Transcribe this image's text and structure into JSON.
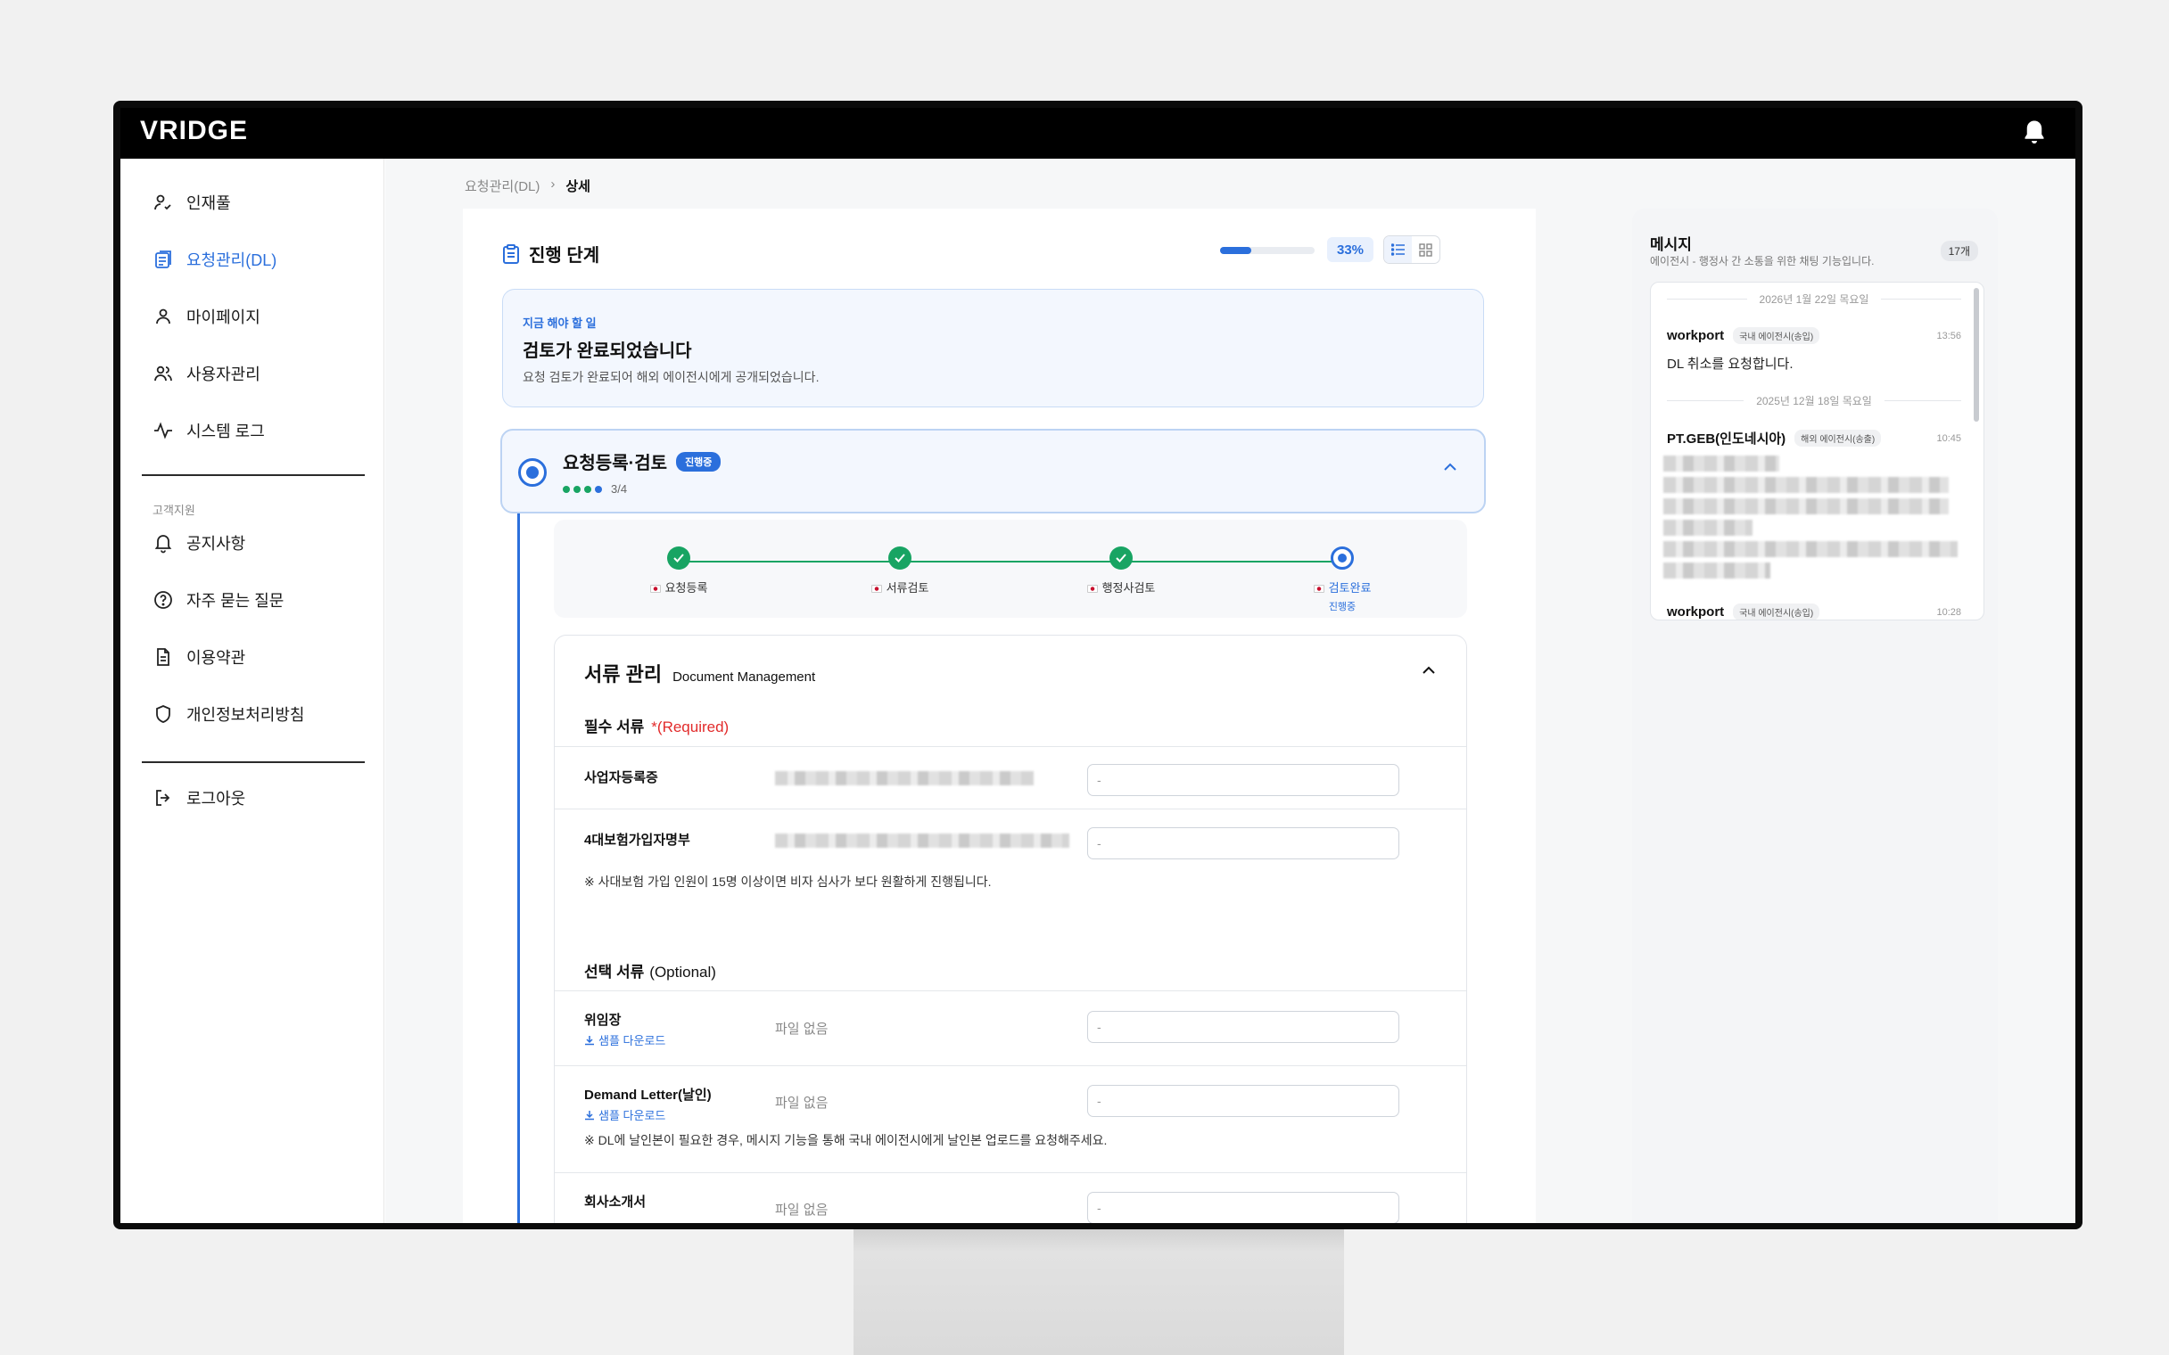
{
  "app": {
    "logo": "VRIDGE"
  },
  "sidebar": {
    "items": [
      {
        "label": "인재풀"
      },
      {
        "label": "요청관리(DL)"
      },
      {
        "label": "마이페이지"
      },
      {
        "label": "사용자관리"
      },
      {
        "label": "시스템 로그"
      }
    ],
    "section": "고객지원",
    "support": [
      {
        "label": "공지사항"
      },
      {
        "label": "자주 묻는 질문"
      },
      {
        "label": "이용약관"
      },
      {
        "label": "개인정보처리방침"
      }
    ],
    "logout": "로그아웃"
  },
  "breadcrumb": {
    "parent": "요청관리(DL)",
    "sep": "›",
    "current": "상세"
  },
  "progress": {
    "title": "진행 단계",
    "percent_label": "33%",
    "percent": 33
  },
  "todo": {
    "tag": "지금 해야 할 일",
    "title": "검토가 완료되었습니다",
    "desc": "요청 검토가 완료되어 해외 에이전시에게 공개되었습니다."
  },
  "stage": {
    "title": "요청등록·검토",
    "badge": "진행중",
    "count": "3/4"
  },
  "steps": [
    {
      "label": "요청등록",
      "status": "done"
    },
    {
      "label": "서류검토",
      "status": "done"
    },
    {
      "label": "행정사검토",
      "status": "done"
    },
    {
      "label": "검토완료",
      "status": "current",
      "sub": "진행중"
    }
  ],
  "documents": {
    "title": "서류 관리",
    "title_en": "Document Management",
    "required_label": "필수 서류",
    "required_tag": "*(Required)",
    "required": [
      {
        "name": "사업자등록증",
        "input": "-"
      },
      {
        "name": "4대보험가입자명부",
        "input": "-"
      }
    ],
    "required_note": "※ 사대보험 가입 인원이 15명 이상이면 비자 심사가 보다 원활하게 진행됩니다.",
    "optional_label": "선택 서류",
    "optional_tag": "(Optional)",
    "optional": [
      {
        "name": "위임장",
        "download": "샘플 다운로드",
        "file": "파일 없음",
        "input": "-"
      },
      {
        "name": "Demand Letter(날인)",
        "download": "샘플 다운로드",
        "file": "파일 없음",
        "input": "-"
      },
      {
        "name": "회사소개서",
        "file": "파일 없음",
        "input": "-"
      }
    ],
    "optional_note": "※ DL에 날인본이 필요한 경우, 메시지 기능을 통해 국내 에이전시에게 날인본 업로드를 요청해주세요."
  },
  "messages": {
    "title": "메시지",
    "subtitle": "에이전시 - 행정사 간 소통을 위한 채팅 기능입니다.",
    "count": "17개",
    "items": [
      {
        "date": "2026년 1월 22일 목요일",
        "sender": "workport",
        "tag": "국내 에이전시(송입)",
        "time": "13:56",
        "body": "DL 취소를 요청합니다."
      },
      {
        "date": "2025년 12월 18일 목요일",
        "sender": "PT.GEB(인도네시아)",
        "tag": "해외 에이전시(송출)",
        "time": "10:45"
      },
      {
        "sender": "workport",
        "tag": "국내 에이전시(송입)",
        "time": "10:28"
      }
    ]
  },
  "colors": {
    "accent": "#2b6fdc",
    "success": "#18a463",
    "required": "#e22b2b"
  }
}
